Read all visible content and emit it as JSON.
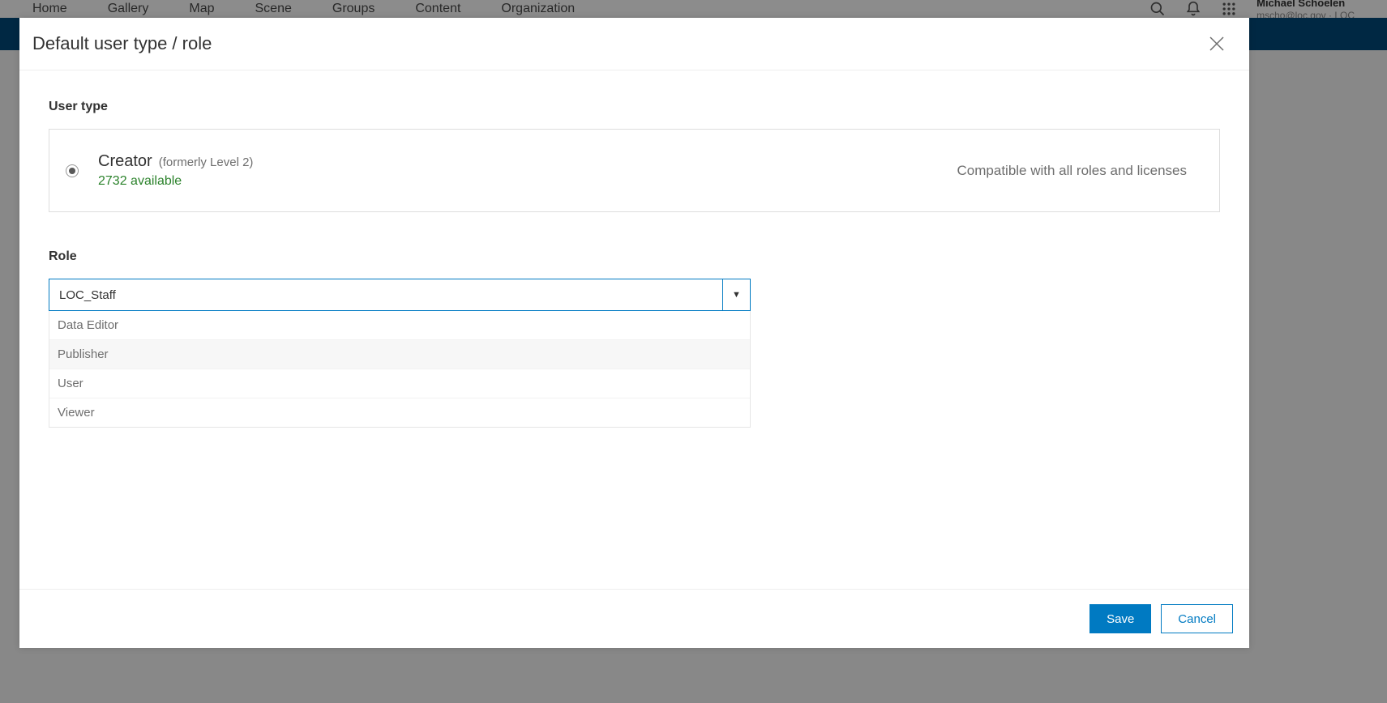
{
  "nav": {
    "items": [
      "Home",
      "Gallery",
      "Map",
      "Scene",
      "Groups",
      "Content",
      "Organization"
    ]
  },
  "user": {
    "name": "Michael Schoelen",
    "sub": "mscho@loc.gov · LOC"
  },
  "modal": {
    "title": "Default user type / role",
    "user_type_label": "User type",
    "role_label": "Role",
    "creator": {
      "title": "Creator",
      "subtitle": "(formerly Level 2)",
      "available": "2732 available",
      "compat": "Compatible with all roles and licenses"
    },
    "role": {
      "selected": "LOC_Staff",
      "options": [
        "Data Editor",
        "Publisher",
        "User",
        "Viewer"
      ]
    },
    "buttons": {
      "save": "Save",
      "cancel": "Cancel"
    }
  }
}
